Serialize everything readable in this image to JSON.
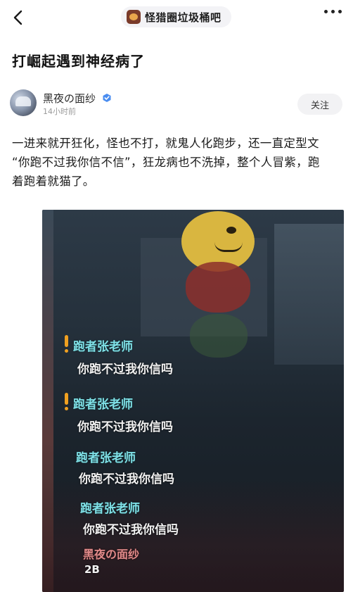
{
  "header": {
    "forum_name": "怪猎圈垃圾桶吧",
    "back_icon": "chevron-left-icon",
    "more_icon": "more-dots-icon"
  },
  "post": {
    "title": "打崛起遇到神经病了",
    "author": {
      "name": "黑夜の面纱",
      "time": "14小时前",
      "verified_color": "#4a8df0"
    },
    "follow_label": "关注",
    "body_lines": [
      "一进来就开狂化，怪也不打，就鬼人化跑步，还一直定型文",
      "“你跑不过我你信不信”，狂龙病也不洗掉，整个人冒紫，跑",
      "着跑着就猫了。"
    ]
  },
  "image": {
    "chat": [
      {
        "name": "跑者张老师",
        "msg": "你跑不过我你信吗",
        "alert": true
      },
      {
        "name": "跑者张老师",
        "msg": "你跑不过我你信吗",
        "alert": true
      },
      {
        "name": "跑者张老师",
        "msg": "你跑不过我你信吗",
        "alert": false
      },
      {
        "name": "跑者张老师",
        "msg": "你跑不过我你信吗",
        "alert": false
      }
    ],
    "self": {
      "name": "黑夜の面纱",
      "msg": "2B"
    }
  }
}
